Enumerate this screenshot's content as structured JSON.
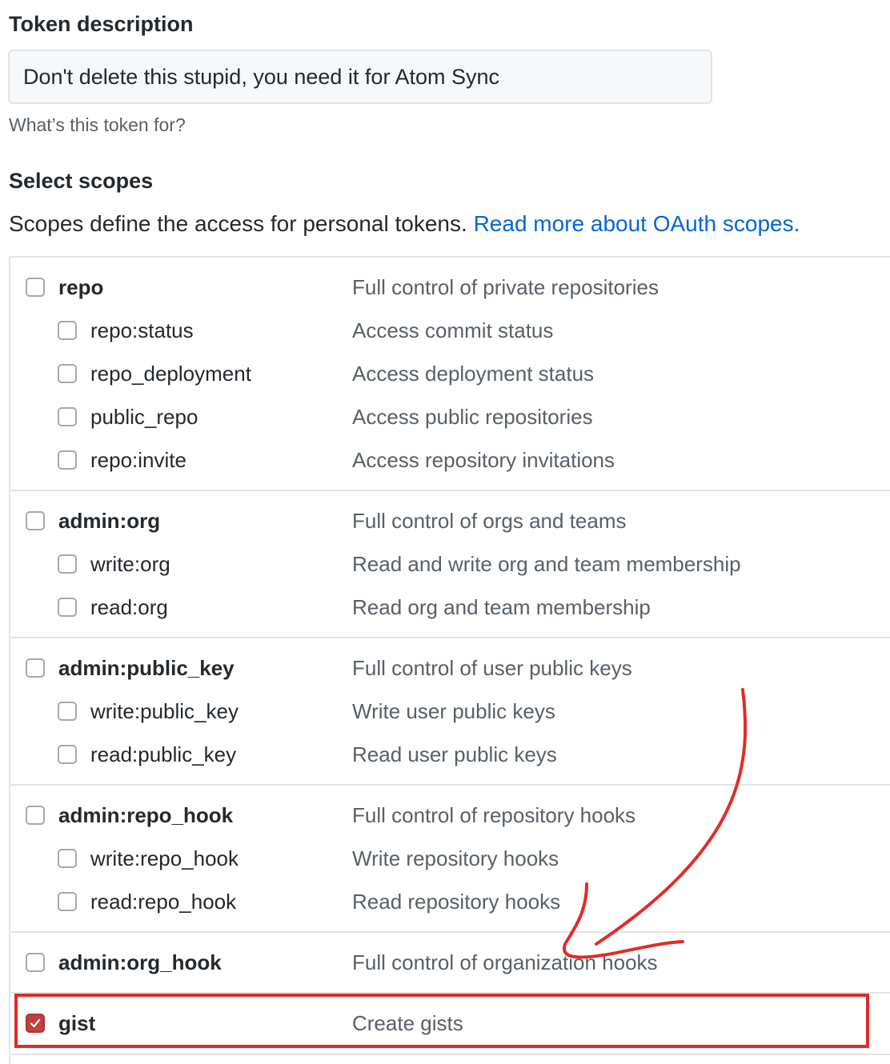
{
  "token": {
    "heading": "Token description",
    "value": "Don't delete this stupid, you need it for Atom Sync",
    "note": "What’s this token for?"
  },
  "scopes_section": {
    "heading": "Select scopes",
    "description": "Scopes define the access for personal tokens.",
    "link": "Read more about OAuth scopes."
  },
  "scopes": {
    "repo": {
      "label": "repo",
      "desc": "Full control of private repositories",
      "checked": false
    },
    "repo_status": {
      "label": "repo:status",
      "desc": "Access commit status",
      "checked": false
    },
    "repo_deployment": {
      "label": "repo_deployment",
      "desc": "Access deployment status",
      "checked": false
    },
    "public_repo": {
      "label": "public_repo",
      "desc": "Access public repositories",
      "checked": false
    },
    "repo_invite": {
      "label": "repo:invite",
      "desc": "Access repository invitations",
      "checked": false
    },
    "admin_org": {
      "label": "admin:org",
      "desc": "Full control of orgs and teams",
      "checked": false
    },
    "write_org": {
      "label": "write:org",
      "desc": "Read and write org and team membership",
      "checked": false
    },
    "read_org": {
      "label": "read:org",
      "desc": "Read org and team membership",
      "checked": false
    },
    "admin_public_key": {
      "label": "admin:public_key",
      "desc": "Full control of user public keys",
      "checked": false
    },
    "write_public_key": {
      "label": "write:public_key",
      "desc": "Write user public keys",
      "checked": false
    },
    "read_public_key": {
      "label": "read:public_key",
      "desc": "Read user public keys",
      "checked": false
    },
    "admin_repo_hook": {
      "label": "admin:repo_hook",
      "desc": "Full control of repository hooks",
      "checked": false
    },
    "write_repo_hook": {
      "label": "write:repo_hook",
      "desc": "Write repository hooks",
      "checked": false
    },
    "read_repo_hook": {
      "label": "read:repo_hook",
      "desc": "Read repository hooks",
      "checked": false
    },
    "admin_org_hook": {
      "label": "admin:org_hook",
      "desc": "Full control of organization hooks",
      "checked": false
    },
    "gist": {
      "label": "gist",
      "desc": "Create gists",
      "checked": true
    }
  },
  "annotation": {
    "color": "#e22b26"
  }
}
